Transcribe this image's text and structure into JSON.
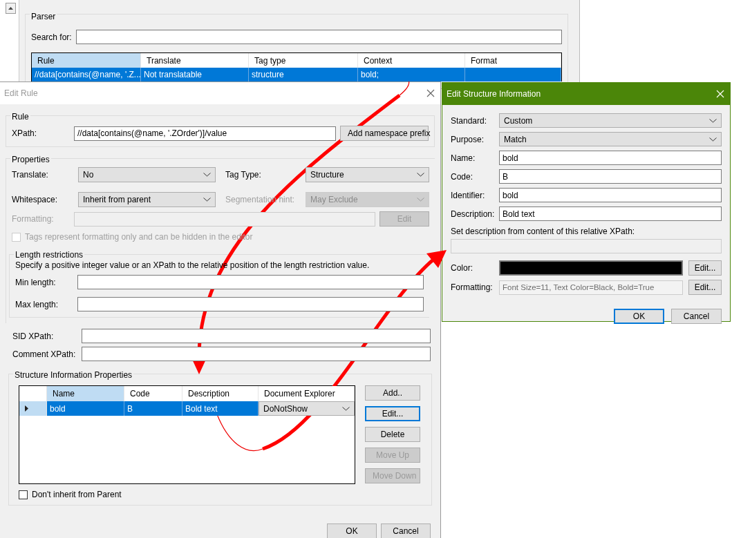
{
  "parser": {
    "title": "Parser",
    "search_label": "Search for:",
    "columns": [
      {
        "label": "Rule",
        "selected": true
      },
      {
        "label": "Translate",
        "selected": false
      },
      {
        "label": "Tag type",
        "selected": false
      },
      {
        "label": "Context",
        "selected": false
      },
      {
        "label": "Format",
        "selected": false
      }
    ],
    "rows": [
      {
        "cells": [
          "//data[contains(@name, '.Z...",
          "Not translatable",
          "structure",
          "bold;",
          ""
        ],
        "selected": true
      }
    ]
  },
  "edit_rule": {
    "title": "Edit Rule",
    "rule": {
      "title": "Rule",
      "xpath_label": "XPath:",
      "xpath_value": "//data[contains(@name, '.ZOrder')]/value",
      "prefix_button": "Add namespace prefix"
    },
    "properties": {
      "title": "Properties",
      "fields": [
        {
          "label": "Translate:",
          "value": "No",
          "disabled": false
        },
        {
          "label": "Tag Type:",
          "value": "Structure",
          "disabled": false
        },
        {
          "label": "Whitespace:",
          "value": "Inherit from parent",
          "disabled": false
        },
        {
          "label": "Segmentation hint:",
          "value": "May Exclude",
          "disabled": true
        }
      ],
      "formatting": {
        "label": "Formatting:",
        "button": "Edit",
        "disabled": true
      },
      "hidden_tags": {
        "label": "Tags represent formatting only and can be hidden in the editor",
        "checked": false,
        "disabled": true
      }
    },
    "length": {
      "title": "Length restrictions",
      "hint": "Specify a positive integer value or an XPath to the relative position of the length restriction value.",
      "min_label": "Min length:",
      "max_label": "Max length:"
    },
    "sid_label": "SID XPath:",
    "comment_label": "Comment XPath:",
    "structure": {
      "title": "Structure Information Properties",
      "columns": [
        {
          "label": "Name",
          "selected": true
        },
        {
          "label": "Code",
          "selected": false
        },
        {
          "label": "Description",
          "selected": false
        },
        {
          "label": "Document Explorer",
          "selected": false
        }
      ],
      "rows": [
        {
          "name": "bold",
          "code": "B",
          "description": "Bold text",
          "explorer": "DoNotShow",
          "selected": true
        }
      ],
      "buttons": [
        {
          "label": "Add..",
          "disabled": false,
          "focused": false
        },
        {
          "label": "Edit...",
          "disabled": false,
          "focused": true
        },
        {
          "label": "Delete",
          "disabled": false,
          "focused": false
        },
        {
          "label": "Move Up",
          "disabled": true,
          "focused": false
        },
        {
          "label": "Move Down",
          "disabled": true,
          "focused": false
        }
      ],
      "inherit": {
        "label": "Don't inherit from Parent",
        "checked": false
      }
    },
    "buttons": [
      {
        "label": "OK",
        "focused": false
      },
      {
        "label": "Cancel",
        "focused": false
      }
    ]
  },
  "edit_structure": {
    "title": "Edit Structure Information",
    "fields": [
      {
        "kind": "select",
        "label": "Standard:",
        "value": "Custom"
      },
      {
        "kind": "select",
        "label": "Purpose:",
        "value": "Match"
      },
      {
        "kind": "text",
        "label": "Name:",
        "value": "bold"
      },
      {
        "kind": "text",
        "label": "Code:",
        "value": "B"
      },
      {
        "kind": "text",
        "label": "Identifier:",
        "value": "bold"
      },
      {
        "kind": "text",
        "label": "Description:",
        "value": "Bold text"
      }
    ],
    "xpath_label": "Set description from content of this relative XPath:",
    "color": {
      "label": "Color:",
      "color": "#000000",
      "button": "Edit..."
    },
    "formatting": {
      "label": "Formatting:",
      "value": "Font Size=11, Text Color=Black, Bold=True",
      "button": "Edit..."
    },
    "buttons": [
      {
        "label": "OK",
        "focused": true
      },
      {
        "label": "Cancel",
        "focused": false
      }
    ]
  }
}
